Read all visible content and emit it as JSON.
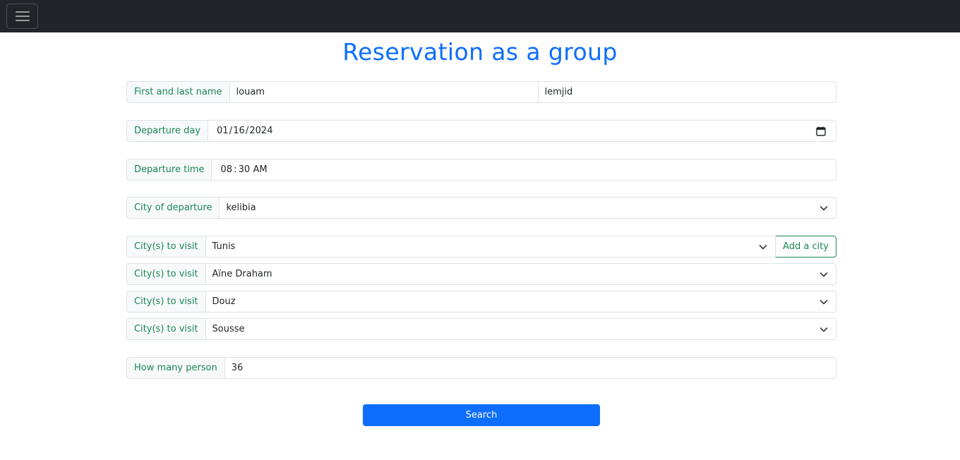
{
  "navbar": {
    "toggler_icon": "hamburger-icon"
  },
  "title": "Reservation as a group",
  "name_row": {
    "label": "First and last name",
    "first_name": "louam",
    "last_name": "lemjid"
  },
  "departure_day": {
    "label": "Departure day",
    "value": "01 / 16 / 2024",
    "icon": "calendar-icon"
  },
  "departure_time": {
    "label": "Departure time",
    "value": "08 : 30  AM"
  },
  "city_departure": {
    "label": "City of departure",
    "value": "kelibia"
  },
  "cities_to_visit": [
    {
      "label": "City(s) to visit",
      "value": "Tunis"
    },
    {
      "label": "City(s) to visit",
      "value": "Aïne Draham"
    },
    {
      "label": "City(s) to visit",
      "value": "Douz"
    },
    {
      "label": "City(s) to visit",
      "value": "Sousse"
    }
  ],
  "add_city_label": "Add a city",
  "persons": {
    "label": "How many person",
    "value": "36"
  },
  "search_label": "Search",
  "colors": {
    "primary": "#0d6efd",
    "success": "#198754",
    "navbar": "#212529"
  }
}
